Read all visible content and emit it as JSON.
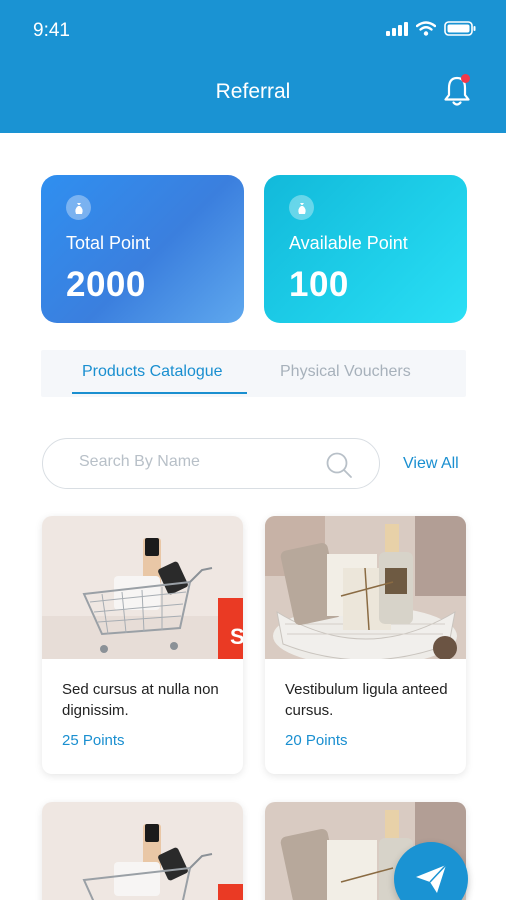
{
  "status_bar": {
    "time": "9:41"
  },
  "header": {
    "title": "Referral"
  },
  "points": {
    "total": {
      "label": "Total Point",
      "value": "2000"
    },
    "available": {
      "label": "Available Point",
      "value": "100"
    }
  },
  "tabs": [
    {
      "label": "Products Catalogue",
      "active": true
    },
    {
      "label": "Physical Vouchers",
      "active": false
    }
  ],
  "search": {
    "placeholder": "Search By Name",
    "view_all": "View All"
  },
  "products": [
    {
      "title": "Sed cursus at nulla non dignissim.",
      "points": "25 Points",
      "image": "cosmetics-cart"
    },
    {
      "title": "Vestibulum ligula anteed cursus.",
      "points": "20 Points",
      "image": "gift-basket"
    },
    {
      "title": "",
      "points": "",
      "image": "cosmetics-cart"
    },
    {
      "title": "",
      "points": "",
      "image": "gift-basket"
    }
  ],
  "colors": {
    "primary": "#1a93d3",
    "accent_red": "#f2384a",
    "total_card": "#3b7fde",
    "available_card": "#1fd0ea"
  }
}
